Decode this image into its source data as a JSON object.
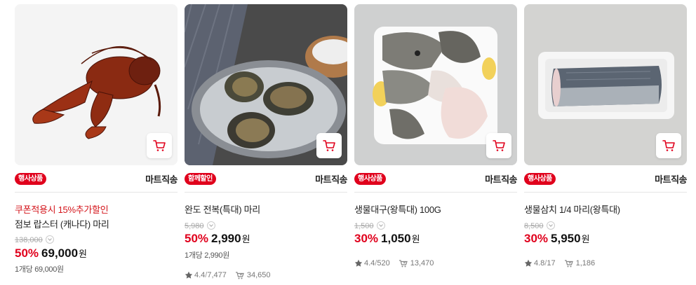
{
  "products": [
    {
      "badge": "행사상품",
      "ship": "마트직송",
      "promo": "쿠폰적용시 15%추가할인",
      "title": "점보 랍스터 (캐나다) 마리",
      "orig_price": "138,000",
      "discount": "50%",
      "price": "69,000",
      "won": "원",
      "unit_price": "1개당 69,000원",
      "rating": "",
      "reviews": "",
      "purchases": ""
    },
    {
      "badge": "함께할인",
      "ship": "마트직송",
      "promo": "",
      "title": "완도 전복(특대) 마리",
      "orig_price": "5,980",
      "discount": "50%",
      "price": "2,990",
      "won": "원",
      "unit_price": "1개당 2,990원",
      "rating": "4.4",
      "reviews": "7,477",
      "purchases": "34,650"
    },
    {
      "badge": "행사상품",
      "ship": "마트직송",
      "promo": "",
      "title": "생물대구(왕특대) 100G",
      "orig_price": "1,500",
      "discount": "30%",
      "price": "1,050",
      "won": "원",
      "unit_price": "",
      "rating": "4.4",
      "reviews": "520",
      "purchases": "13,470"
    },
    {
      "badge": "행사상품",
      "ship": "마트직송",
      "promo": "",
      "title": "생물삼치 1/4 마리(왕특대)",
      "orig_price": "8,500",
      "discount": "30%",
      "price": "5,950",
      "won": "원",
      "unit_price": "",
      "rating": "4.8",
      "reviews": "17",
      "purchases": "1,186"
    }
  ],
  "review_sep": "/",
  "colors": {
    "accent": "#e0001c",
    "badge_bg": "#e0001c"
  },
  "icons": {
    "cart": "cart-icon",
    "star": "star-icon",
    "purchase": "purchase-count-icon"
  }
}
